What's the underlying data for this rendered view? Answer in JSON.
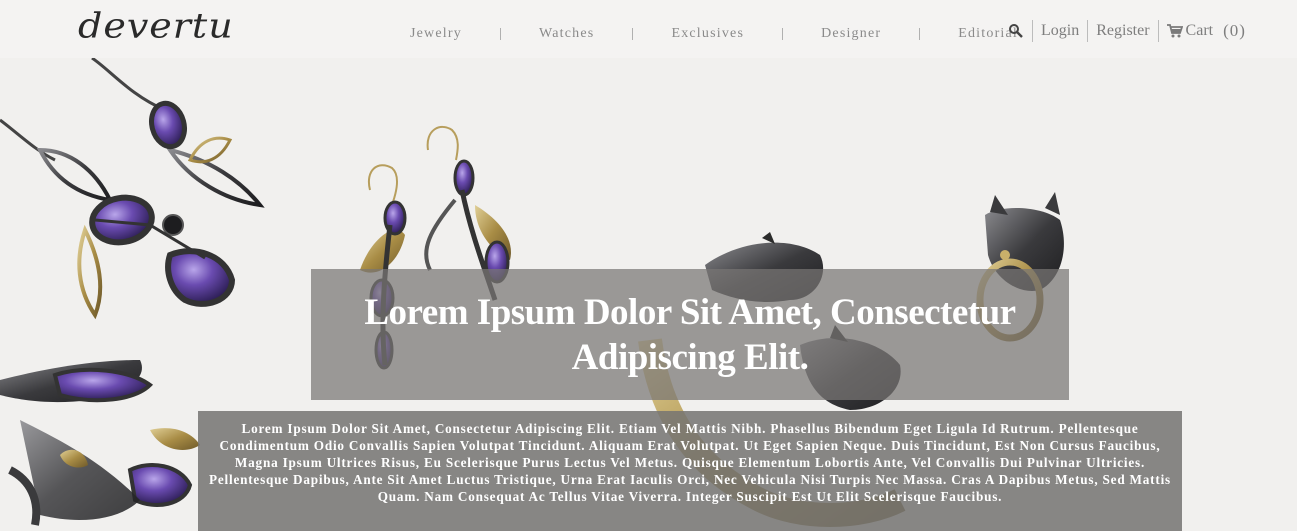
{
  "brand": {
    "logo_text": "devertu"
  },
  "nav": {
    "items": [
      {
        "label": "Jewelry"
      },
      {
        "label": "Watches"
      },
      {
        "label": "Exclusives"
      },
      {
        "label": "Designer"
      },
      {
        "label": "Editorial"
      }
    ]
  },
  "utility": {
    "search_icon": "search-icon",
    "login_label": "Login",
    "register_label": "Register",
    "cart_label": "Cart",
    "cart_count": "(0)",
    "cart_icon": "shopping-cart-icon"
  },
  "hero": {
    "title": "Lorem Ipsum Dolor Sit Amet, Consectetur Adipiscing Elit.",
    "body": "Lorem Ipsum Dolor Sit Amet, Consectetur Adipiscing Elit. Etiam Vel Mattis Nibh. Phasellus Bibendum Eget Ligula Id Rutrum. Pellentesque Condimentum Odio Convallis Sapien Volutpat Tincidunt. Aliquam Erat Volutpat. Ut Eget Sapien Neque. Duis Tincidunt, Est Non Cursus Faucibus, Magna Ipsum Ultrices Risus, Eu Scelerisque Purus Lectus Vel Metus. Quisque Elementum Lobortis Ante, Vel Convallis Dui Pulvinar Ultricies. Pellentesque Dapibus, Ante Sit Amet Luctus Tristique, Urna Erat Iaculis Orci, Nec Vehicula Nisi Turpis Nec Massa. Cras A Dapibus Metus, Sed Mattis Quam. Nam Consequat Ac Tellus Vitae Viverra. Integer Suscipit Est Ut Elit Scelerisque Faucibus."
  },
  "colors": {
    "page_bg": "#f4f3f1",
    "nav_text": "#8a8a8a",
    "overlay": "#787674",
    "amethyst": "#5b3f9a",
    "gunmetal": "#3a3a3c",
    "gold": "#b8a266"
  }
}
